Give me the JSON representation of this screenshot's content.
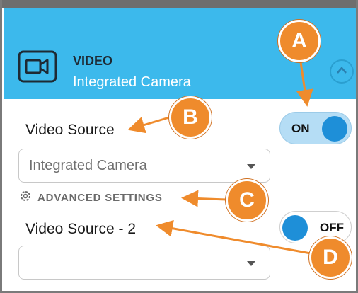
{
  "header": {
    "title": "VIDEO",
    "subtitle": "Integrated Camera",
    "camera_icon": "video-camera-icon",
    "collapse_icon": "chevron-up-icon"
  },
  "video_source": {
    "label": "Video Source",
    "toggle_text": "ON",
    "toggle_on": true,
    "dropdown_value": "Integrated Camera"
  },
  "advanced": {
    "label": "ADVANCED SETTINGS",
    "icon": "gear-icon"
  },
  "video_source_2": {
    "label": "Video Source - 2",
    "toggle_text": "OFF",
    "toggle_on": false,
    "dropdown_value": ""
  },
  "callouts": [
    "A",
    "B",
    "C",
    "D"
  ],
  "colors": {
    "header_bg": "#3cb9ec",
    "toggle_knob": "#1e8fd8",
    "callout": "#ef8b2c"
  }
}
